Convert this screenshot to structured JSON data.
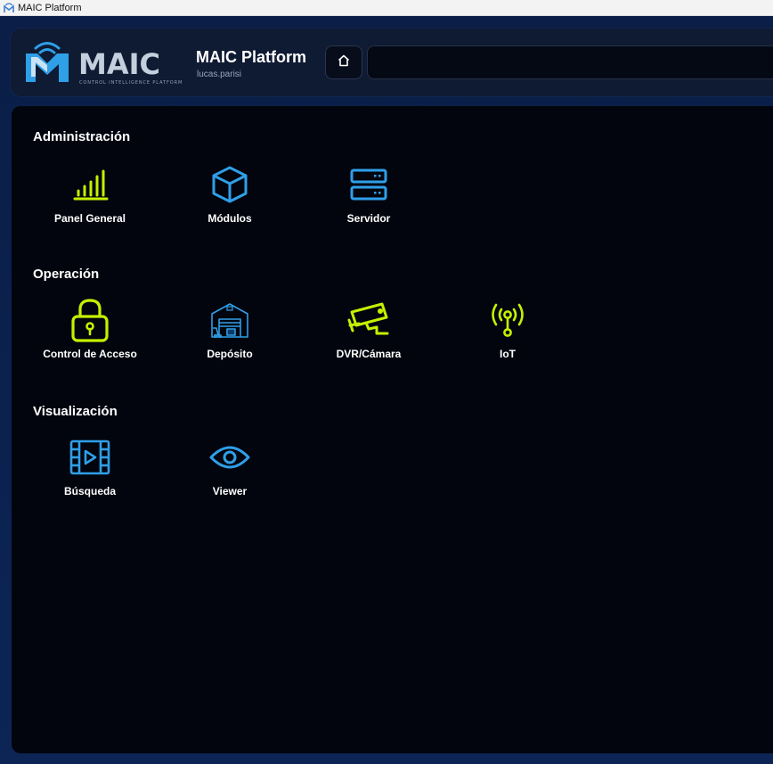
{
  "window": {
    "title": "MAIC Platform"
  },
  "header": {
    "logo_text": "MAIC",
    "logo_tagline": "CONTROL INTELLIGENCE PLATFORM",
    "title": "MAIC Platform",
    "username": "lucas.parisi",
    "search_value": ""
  },
  "colors": {
    "accent_lime": "#c6f000",
    "accent_blue": "#2f9fe8",
    "background": "#02050e"
  },
  "sections": [
    {
      "title": "Administración",
      "items": [
        {
          "label": "Panel General",
          "icon": "bar-chart-icon"
        },
        {
          "label": "Módulos",
          "icon": "cube-icon"
        },
        {
          "label": "Servidor",
          "icon": "server-icon"
        }
      ]
    },
    {
      "title": "Operación",
      "items": [
        {
          "label": "Control de Acceso",
          "icon": "padlock-icon"
        },
        {
          "label": "Depósito",
          "icon": "warehouse-icon"
        },
        {
          "label": "DVR/Cámara",
          "icon": "security-camera-icon"
        },
        {
          "label": "IoT",
          "icon": "antenna-icon"
        }
      ]
    },
    {
      "title": "Visualización",
      "items": [
        {
          "label": "Búsqueda",
          "icon": "video-film-icon"
        },
        {
          "label": "Viewer",
          "icon": "eye-icon"
        }
      ]
    }
  ]
}
